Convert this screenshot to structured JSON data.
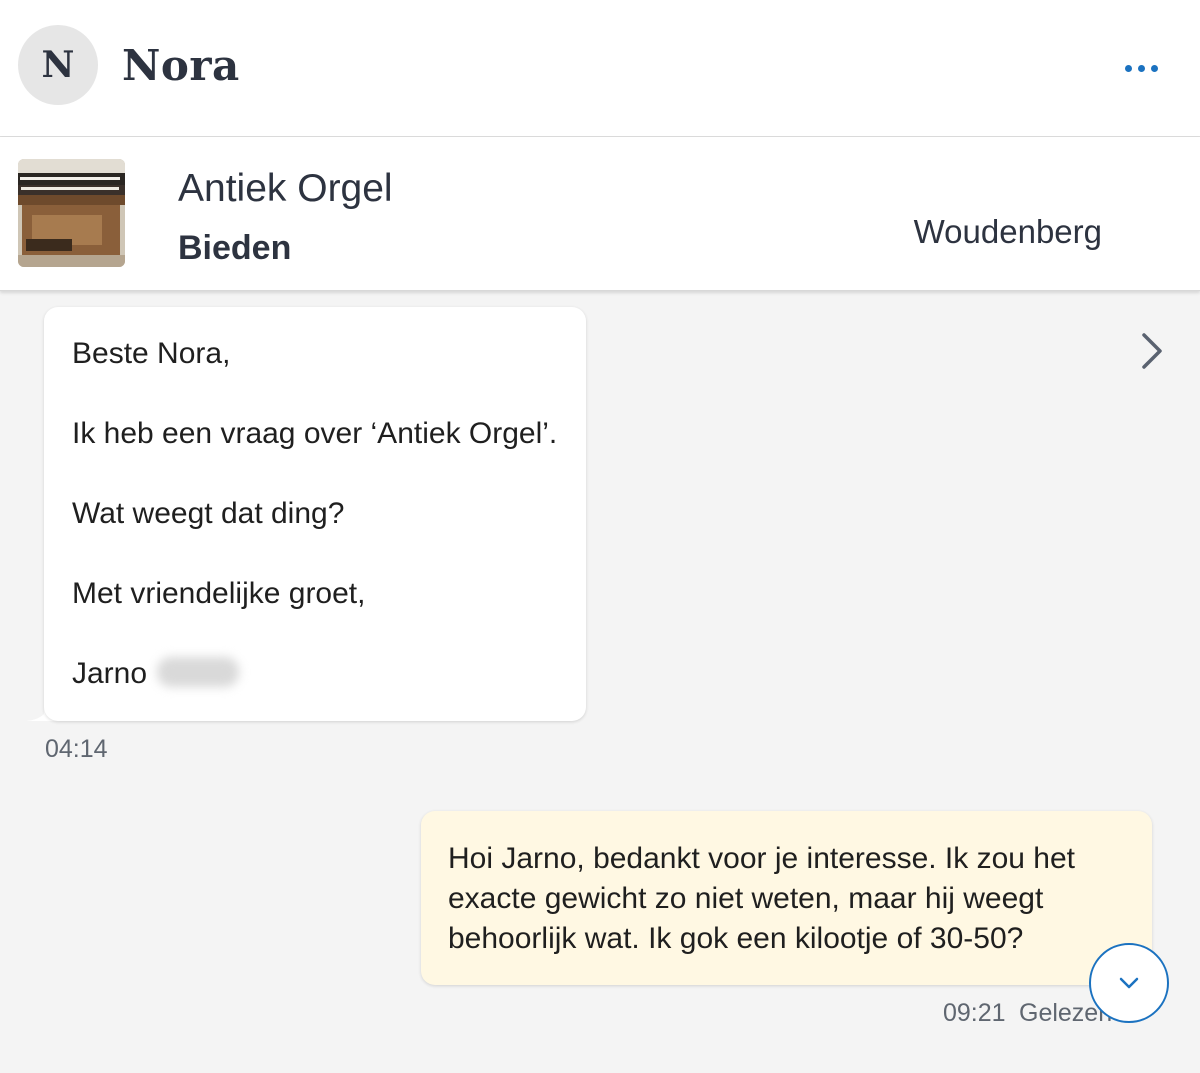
{
  "header": {
    "avatar_initial": "N",
    "contact_name": "Nora",
    "more_icon": "more-dots-icon",
    "accent_color": "#1b72c0"
  },
  "listing": {
    "title": "Antiek Orgel",
    "action": "Bieden",
    "location": "Woudenberg",
    "chevron_icon": "chevron-right-icon"
  },
  "messages": [
    {
      "direction": "incoming",
      "lines": [
        "Beste Nora,",
        "Ik heb een vraag over ‘Antiek Orgel’.",
        "Wat weegt dat ding?",
        "Met vriendelijke groet,",
        "Jarno"
      ],
      "time": "04:14"
    },
    {
      "direction": "outgoing",
      "text": "Hoi Jarno, bedankt voor je interesse. Ik zou het exacte gewicht zo niet weten, maar hij weegt behoorlijk wat. Ik gok een kilootje of 30-50?",
      "time": "09:21",
      "status": "Gelezen",
      "bubble_color": "#fff8e3"
    }
  ],
  "scroll_button": {
    "icon": "chevron-down-icon"
  }
}
